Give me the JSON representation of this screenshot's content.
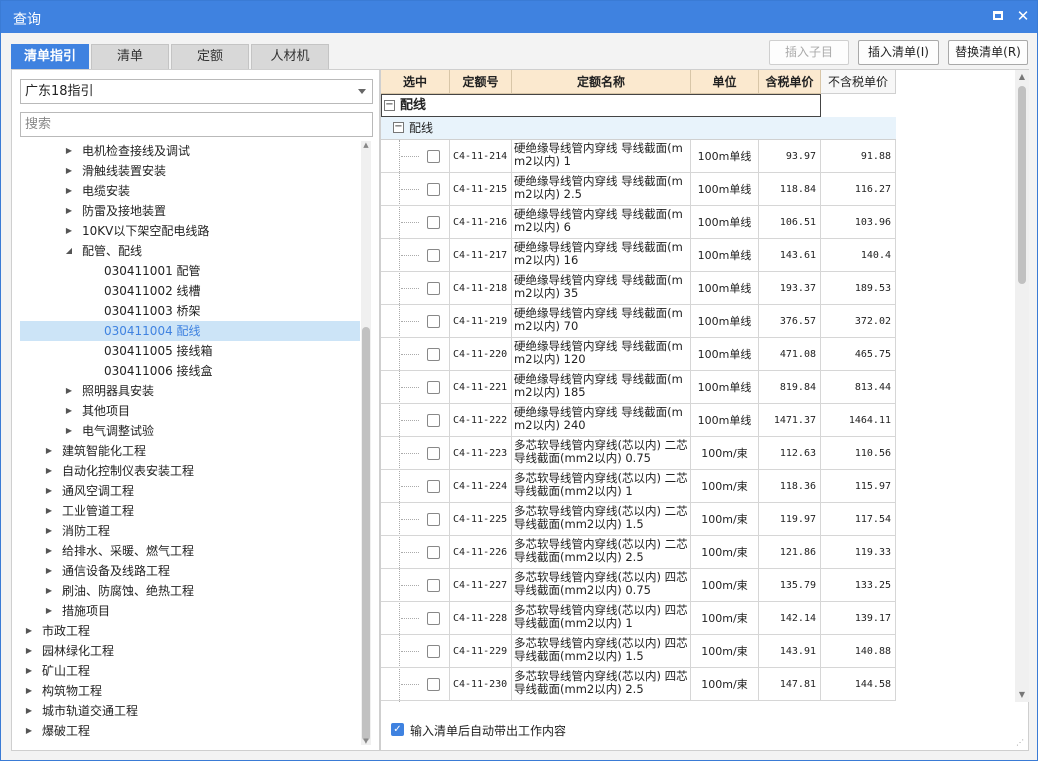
{
  "window": {
    "title": "查询"
  },
  "tabs": [
    "清单指引",
    "清单",
    "定额",
    "人材机"
  ],
  "toolbar": {
    "insert_child": "插入子目",
    "insert_list": "插入清单(I)",
    "replace_list": "替换清单(R)"
  },
  "left": {
    "select_value": "广东18指引",
    "search_placeholder": "搜索",
    "tree": [
      {
        "label": "电机检查接线及调试",
        "level": 2,
        "caret": "▶"
      },
      {
        "label": "滑触线装置安装",
        "level": 2,
        "caret": "▶"
      },
      {
        "label": "电缆安装",
        "level": 2,
        "caret": "▶"
      },
      {
        "label": "防雷及接地装置",
        "level": 2,
        "caret": "▶"
      },
      {
        "label": "10KV以下架空配电线路",
        "level": 2,
        "caret": "▶"
      },
      {
        "label": "配管、配线",
        "level": 2,
        "caret": "◢"
      },
      {
        "label": "030411001  配管",
        "level": 3,
        "caret": ""
      },
      {
        "label": "030411002  线槽",
        "level": 3,
        "caret": ""
      },
      {
        "label": "030411003  桥架",
        "level": 3,
        "caret": ""
      },
      {
        "label": "030411004  配线",
        "level": 3,
        "caret": "",
        "selected": true
      },
      {
        "label": "030411005  接线箱",
        "level": 3,
        "caret": ""
      },
      {
        "label": "030411006  接线盒",
        "level": 3,
        "caret": ""
      },
      {
        "label": "照明器具安装",
        "level": 2,
        "caret": "▶"
      },
      {
        "label": "其他项目",
        "level": 2,
        "caret": "▶"
      },
      {
        "label": "电气调整试验",
        "level": 2,
        "caret": "▶"
      },
      {
        "label": "建筑智能化工程",
        "level": 1,
        "caret": "▶"
      },
      {
        "label": "自动化控制仪表安装工程",
        "level": 1,
        "caret": "▶"
      },
      {
        "label": "通风空调工程",
        "level": 1,
        "caret": "▶"
      },
      {
        "label": "工业管道工程",
        "level": 1,
        "caret": "▶"
      },
      {
        "label": "消防工程",
        "level": 1,
        "caret": "▶"
      },
      {
        "label": "给排水、采暖、燃气工程",
        "level": 1,
        "caret": "▶"
      },
      {
        "label": "通信设备及线路工程",
        "level": 1,
        "caret": "▶"
      },
      {
        "label": "刷油、防腐蚀、绝热工程",
        "level": 1,
        "caret": "▶"
      },
      {
        "label": "措施项目",
        "level": 1,
        "caret": "▶"
      },
      {
        "label": "市政工程",
        "level": 0,
        "caret": "▶"
      },
      {
        "label": "园林绿化工程",
        "level": 0,
        "caret": "▶"
      },
      {
        "label": "矿山工程",
        "level": 0,
        "caret": "▶"
      },
      {
        "label": "构筑物工程",
        "level": 0,
        "caret": "▶"
      },
      {
        "label": "城市轨道交通工程",
        "level": 0,
        "caret": "▶"
      },
      {
        "label": "爆破工程",
        "level": 0,
        "caret": "▶"
      }
    ]
  },
  "grid": {
    "headers": {
      "select": "选中",
      "code": "定额号",
      "name": "定额名称",
      "unit": "单位",
      "price_tax": "含税单价",
      "price_notax": "不含税单价"
    },
    "group1": "配线",
    "group2": "配线",
    "rows": [
      {
        "code": "C4-11-214",
        "name": "硬绝缘导线管内穿线 导线截面(mm2以内) 1",
        "unit": "100m单线",
        "price_tax": "93.97",
        "price_notax": "91.88"
      },
      {
        "code": "C4-11-215",
        "name": "硬绝缘导线管内穿线 导线截面(mm2以内) 2.5",
        "unit": "100m单线",
        "price_tax": "118.84",
        "price_notax": "116.27"
      },
      {
        "code": "C4-11-216",
        "name": "硬绝缘导线管内穿线 导线截面(mm2以内) 6",
        "unit": "100m单线",
        "price_tax": "106.51",
        "price_notax": "103.96"
      },
      {
        "code": "C4-11-217",
        "name": "硬绝缘导线管内穿线 导线截面(mm2以内) 16",
        "unit": "100m单线",
        "price_tax": "143.61",
        "price_notax": "140.4"
      },
      {
        "code": "C4-11-218",
        "name": "硬绝缘导线管内穿线 导线截面(mm2以内) 35",
        "unit": "100m单线",
        "price_tax": "193.37",
        "price_notax": "189.53"
      },
      {
        "code": "C4-11-219",
        "name": "硬绝缘导线管内穿线 导线截面(mm2以内) 70",
        "unit": "100m单线",
        "price_tax": "376.57",
        "price_notax": "372.02"
      },
      {
        "code": "C4-11-220",
        "name": "硬绝缘导线管内穿线 导线截面(mm2以内) 120",
        "unit": "100m单线",
        "price_tax": "471.08",
        "price_notax": "465.75"
      },
      {
        "code": "C4-11-221",
        "name": "硬绝缘导线管内穿线 导线截面(mm2以内) 185",
        "unit": "100m单线",
        "price_tax": "819.84",
        "price_notax": "813.44"
      },
      {
        "code": "C4-11-222",
        "name": "硬绝缘导线管内穿线 导线截面(mm2以内) 240",
        "unit": "100m单线",
        "price_tax": "1471.37",
        "price_notax": "1464.11"
      },
      {
        "code": "C4-11-223",
        "name": "多芯软导线管内穿线(芯以内) 二芯 导线截面(mm2以内) 0.75",
        "unit": "100m/束",
        "price_tax": "112.63",
        "price_notax": "110.56"
      },
      {
        "code": "C4-11-224",
        "name": "多芯软导线管内穿线(芯以内) 二芯 导线截面(mm2以内) 1",
        "unit": "100m/束",
        "price_tax": "118.36",
        "price_notax": "115.97"
      },
      {
        "code": "C4-11-225",
        "name": "多芯软导线管内穿线(芯以内) 二芯 导线截面(mm2以内) 1.5",
        "unit": "100m/束",
        "price_tax": "119.97",
        "price_notax": "117.54"
      },
      {
        "code": "C4-11-226",
        "name": "多芯软导线管内穿线(芯以内) 二芯 导线截面(mm2以内) 2.5",
        "unit": "100m/束",
        "price_tax": "121.86",
        "price_notax": "119.33"
      },
      {
        "code": "C4-11-227",
        "name": "多芯软导线管内穿线(芯以内) 四芯 导线截面(mm2以内) 0.75",
        "unit": "100m/束",
        "price_tax": "135.79",
        "price_notax": "133.25"
      },
      {
        "code": "C4-11-228",
        "name": "多芯软导线管内穿线(芯以内) 四芯 导线截面(mm2以内) 1",
        "unit": "100m/束",
        "price_tax": "142.14",
        "price_notax": "139.17"
      },
      {
        "code": "C4-11-229",
        "name": "多芯软导线管内穿线(芯以内) 四芯 导线截面(mm2以内) 1.5",
        "unit": "100m/束",
        "price_tax": "143.91",
        "price_notax": "140.88"
      },
      {
        "code": "C4-11-230",
        "name": "多芯软导线管内穿线(芯以内) 四芯 导线截面(mm2以内) 2.5",
        "unit": "100m/束",
        "price_tax": "147.81",
        "price_notax": "144.58"
      }
    ]
  },
  "footer": {
    "auto_bring_label": "输入清单后自动带出工作内容"
  },
  "colors": {
    "accent": "#3f82e0",
    "header_bg": "#fbe9cf",
    "selected_bg": "#cce4f7"
  }
}
